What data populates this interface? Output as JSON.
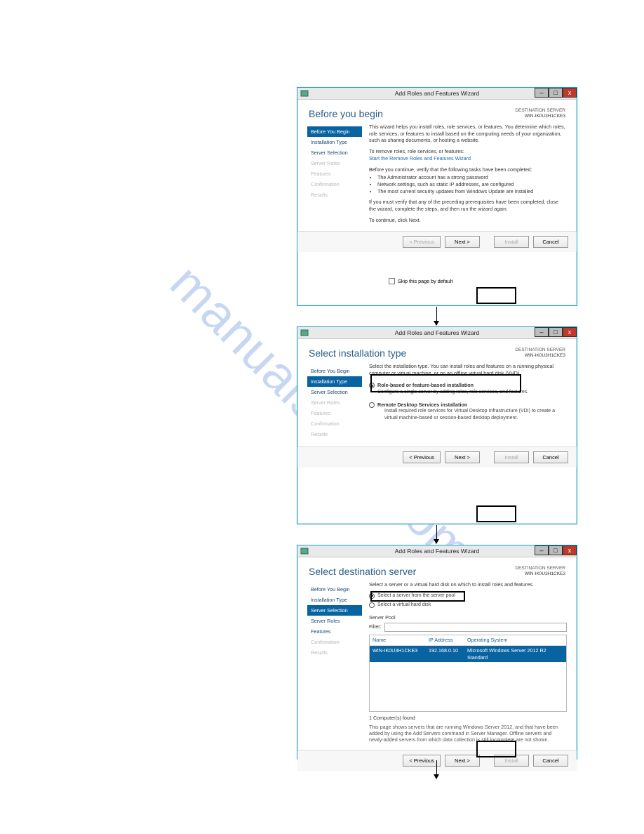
{
  "watermark": "manualshive.com",
  "arrows": {
    "count": 2
  },
  "wizard_title": "Add Roles and Features Wizard",
  "destination": {
    "label": "DESTINATION SERVER",
    "server": "WIN-IK0U3H1CKE3"
  },
  "sidebar_labels": {
    "before": "Before You Begin",
    "type": "Installation Type",
    "selection": "Server Selection",
    "roles": "Server Roles",
    "features": "Features",
    "confirm": "Confirmation",
    "results": "Results"
  },
  "buttons": {
    "prev": "< Previous",
    "prev_u": "< Previous",
    "next": "Next >",
    "install": "Install",
    "cancel": "Cancel"
  },
  "step1": {
    "heading": "Before you begin",
    "p1": "This wizard helps you install roles, role services, or features. You determine which roles, role services, or features to install based on the computing needs of your organization, such as sharing documents, or hosting a website.",
    "p2": "To remove roles, role services, or features:",
    "link": "Start the Remove Roles and Features Wizard",
    "p3": "Before you continue, verify that the following tasks have been completed:",
    "bullets": [
      "The Administrator account has a strong password",
      "Network settings, such as static IP addresses, are configured",
      "The most current security updates from Windows Update are installed"
    ],
    "p4": "If you must verify that any of the preceding prerequisites have been completed, close the wizard, complete the steps, and then run the wizard again.",
    "p5": "To continue, click Next.",
    "skip_label": "Skip this page by default"
  },
  "step2": {
    "heading": "Select installation type",
    "intro": "Select the installation type. You can install roles and features on a running physical computer or virtual machine, or on an offline virtual hard disk (VHD).",
    "opt1_title": "Role-based or feature-based installation",
    "opt1_desc": "Configure a single server by adding roles, role services, and features.",
    "opt2_title": "Remote Desktop Services installation",
    "opt2_desc": "Install required role services for Virtual Desktop Infrastructure (VDI) to create a virtual machine-based or session-based desktop deployment."
  },
  "step3": {
    "heading": "Select destination server",
    "intro": "Select a server or a virtual hard disk on which to install roles and features.",
    "opt1": "Select a server from the server pool",
    "opt2": "Select a virtual hard disk",
    "pool_heading": "Server Pool",
    "filter_label": "Filter:",
    "filter_value": "",
    "columns": {
      "name": "Name",
      "ip": "IP Address",
      "os": "Operating System"
    },
    "rows": [
      {
        "name": "WIN-IK0U3H1CKE3",
        "ip": "192.168.0.10",
        "os": "Microsoft Windows Server 2012 R2 Standard"
      }
    ],
    "found": "1 Computer(s) found",
    "note": "This page shows servers that are running Windows Server 2012, and that have been added by using the Add Servers command in Server Manager. Offline servers and newly-added servers from which data collection is still incomplete are not shown."
  }
}
